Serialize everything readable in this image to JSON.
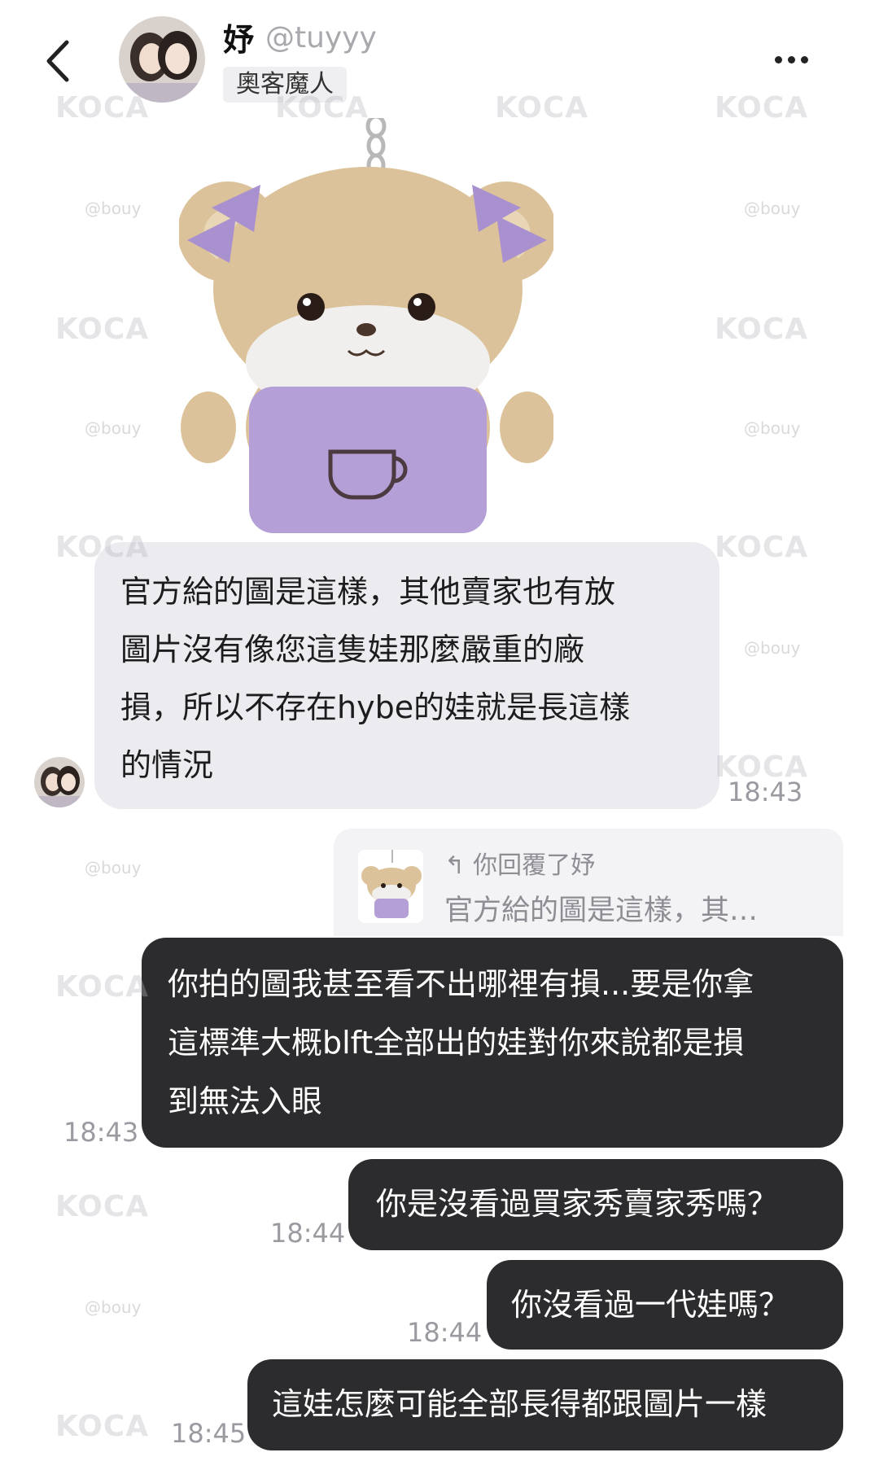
{
  "header": {
    "name": "妤",
    "handle": "@tuyyy",
    "tag": "奧客魔人"
  },
  "icons": {
    "back": "chevron-left-icon",
    "more": "ellipsis-icon",
    "reply": "reply-arrow-icon"
  },
  "messages": {
    "incoming_1": {
      "lines": [
        "官方給的圖是這樣，其他賣家也有放",
        "圖片沒有像您這隻娃那麼嚴重的廠",
        "損，所以不存在hybe的娃就是長這樣",
        "的情況"
      ],
      "time": "18:43"
    },
    "reply_quote": {
      "header": "你回覆了妤",
      "snippet": "官方給的圖是這樣，其…"
    },
    "outgoing_1": {
      "lines": [
        "你拍的圖我甚至看不出哪裡有損...要是你拿",
        "這標準大概blft全部出的娃對你來說都是損",
        "到無法入眼"
      ],
      "time": "18:43"
    },
    "outgoing_2": {
      "text": "你是沒看過買家秀賣家秀嗎？",
      "time": "18:44"
    },
    "outgoing_3": {
      "text": "你沒看過一代娃嗎？",
      "time": "18:44"
    },
    "outgoing_4": {
      "text": "這娃怎麼可能全部長得都跟圖片一樣",
      "time": "18:45"
    }
  },
  "watermarks": {
    "main": "KOCA",
    "small": "@bouy"
  },
  "colors": {
    "incoming_bubble": "#ececf0",
    "outgoing_bubble": "#2c2c2e",
    "timestamp": "#9a9aa0",
    "bear_fur": "#dcc29a",
    "bear_shirt": "#b49fd6"
  }
}
